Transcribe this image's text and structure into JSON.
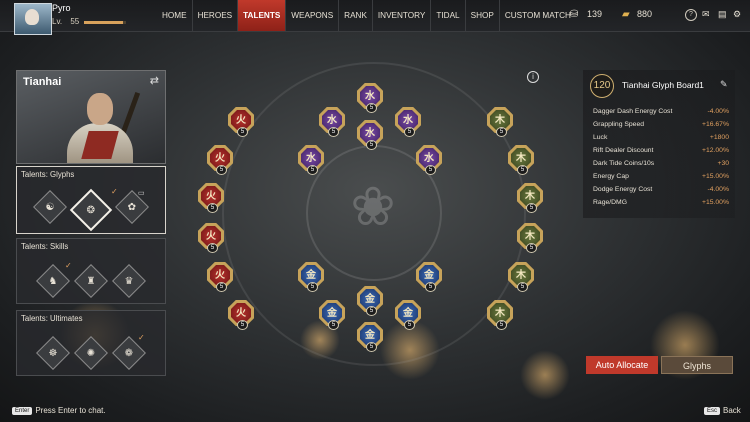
{
  "player": {
    "name": "Pyro",
    "level_label": "Lv.",
    "level": "55",
    "xp_fraction": 0.93
  },
  "nav": [
    {
      "id": "home",
      "label": "HOME",
      "active": false
    },
    {
      "id": "heroes",
      "label": "HEROES",
      "active": false
    },
    {
      "id": "talents",
      "label": "TALENTS",
      "active": true
    },
    {
      "id": "weapons",
      "label": "WEAPONS",
      "active": false
    },
    {
      "id": "rank",
      "label": "RANK",
      "active": false
    },
    {
      "id": "inventory",
      "label": "INVENTORY",
      "active": false
    },
    {
      "id": "tidal",
      "label": "TIDAL",
      "active": false
    },
    {
      "id": "shop",
      "label": "SHOP",
      "active": false
    },
    {
      "id": "custom-match",
      "label": "CUSTOM MATCH",
      "active": false
    }
  ],
  "currency": {
    "coins": "139",
    "gold": "880"
  },
  "hero": {
    "name": "Tianhai",
    "swap_icon": "swap-arrows-icon"
  },
  "talents": {
    "glyphs": {
      "title": "Talents: Glyphs",
      "slots": [
        "glyph-slot-1",
        "glyph-slot-2",
        "glyph-slot-3"
      ],
      "selected": 1
    },
    "skills": {
      "title": "Talents: Skills"
    },
    "ultimates": {
      "title": "Talents: Ultimates"
    }
  },
  "board": {
    "level": "120",
    "title": "Tianhai Glyph Board1",
    "stats": [
      {
        "name": "Dagger Dash Energy Cost",
        "value": "-4.00%"
      },
      {
        "name": "Grappling Speed",
        "value": "+16.67%"
      },
      {
        "name": "Luck",
        "value": "+1800"
      },
      {
        "name": "Rift Dealer Discount",
        "value": "+12.00%"
      },
      {
        "name": "Dark Tide Coins/10s",
        "value": "+30"
      },
      {
        "name": "Energy Cap",
        "value": "+15.00%"
      },
      {
        "name": "Dodge Energy Cost",
        "value": "-4.00%"
      },
      {
        "name": "Rage/DMG",
        "value": "+15.00%"
      }
    ],
    "glyph_level": "5",
    "glyph_colors": {
      "red": "#b8302c",
      "purple": "#7a4aa8",
      "blue": "#3a6ab8",
      "green": "#6a7a3e"
    }
  },
  "buttons": {
    "auto_allocate": "Auto Allocate",
    "glyphs": "Glyphs"
  },
  "footer": {
    "chat_key": "Enter",
    "chat_text": "Press Enter to chat.",
    "back_key": "Esc",
    "back_text": "Back"
  },
  "colors": {
    "accent": "#c0392b",
    "value": "#e0a060"
  }
}
